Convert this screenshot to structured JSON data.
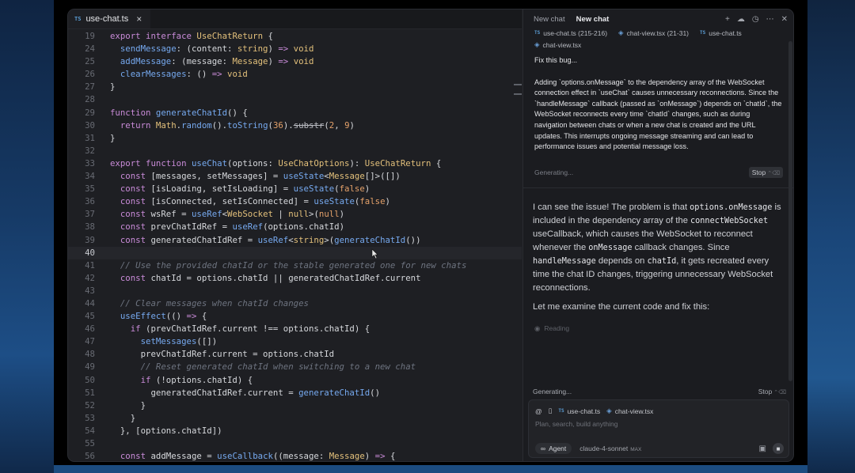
{
  "editor": {
    "tab": {
      "lang": "TS",
      "filename": "use-chat.ts",
      "close": "×"
    },
    "lines": [
      {
        "n": "19",
        "html": "<span class=\"kw\">export</span> <span class=\"kw\">interface</span> <span class=\"ty\">UseChatReturn</span> {"
      },
      {
        "n": "24",
        "html": "  <span class=\"fn\">sendMessage</span>: (content: <span class=\"ty\">string</span>) <span class=\"kw\">=&gt;</span> <span class=\"ty\">void</span>"
      },
      {
        "n": "25",
        "html": "  <span class=\"fn\">addMessage</span>: (message: <span class=\"ty\">Message</span>) <span class=\"kw\">=&gt;</span> <span class=\"ty\">void</span>"
      },
      {
        "n": "26",
        "html": "  <span class=\"fn\">clearMessages</span>: () <span class=\"kw\">=&gt;</span> <span class=\"ty\">void</span>"
      },
      {
        "n": "27",
        "html": "}"
      },
      {
        "n": "28",
        "html": ""
      },
      {
        "n": "29",
        "html": "<span class=\"kw\">function</span> <span class=\"fn\">generateChatId</span>() {"
      },
      {
        "n": "30",
        "html": "  <span class=\"kw\">return</span> <span class=\"ty\">Math</span>.<span class=\"fn\">random</span>().<span class=\"fn\">toString</span>(<span class=\"nm\">36</span>).<span class=\"strike\">substr</span>(<span class=\"nm\">2</span>, <span class=\"nm\">9</span>)"
      },
      {
        "n": "31",
        "html": "}"
      },
      {
        "n": "32",
        "html": ""
      },
      {
        "n": "33",
        "html": "<span class=\"kw\">export</span> <span class=\"kw\">function</span> <span class=\"fn\">useChat</span>(options: <span class=\"ty\">UseChatOptions</span>): <span class=\"ty\">UseChatReturn</span> {"
      },
      {
        "n": "34",
        "html": "  <span class=\"kw\">const</span> [messages, setMessages] = <span class=\"fn\">useState</span>&lt;<span class=\"ty\">Message</span>[]&gt;([])"
      },
      {
        "n": "35",
        "html": "  <span class=\"kw\">const</span> [isLoading, setIsLoading] = <span class=\"fn\">useState</span>(<span class=\"nm\">false</span>)"
      },
      {
        "n": "36",
        "html": "  <span class=\"kw\">const</span> [isConnected, setIsConnected] = <span class=\"fn\">useState</span>(<span class=\"nm\">false</span>)"
      },
      {
        "n": "37",
        "html": "  <span class=\"kw\">const</span> wsRef = <span class=\"fn\">useRef</span>&lt;<span class=\"ty\">WebSocket</span> | <span class=\"ty\">null</span>&gt;(<span class=\"nm\">null</span>)"
      },
      {
        "n": "38",
        "html": "  <span class=\"kw\">const</span> prevChatIdRef = <span class=\"fn\">useRef</span>(options.chatId)"
      },
      {
        "n": "39",
        "html": "  <span class=\"kw\">const</span> generatedChatIdRef = <span class=\"fn\">useRef</span>&lt;<span class=\"ty\">string</span>&gt;(<span class=\"fn\">generateChatId</span>())"
      },
      {
        "n": "40",
        "html": "",
        "active": true
      },
      {
        "n": "41",
        "html": "  <span class=\"cm\">// Use the provided chatId or the stable generated one for new chats</span>"
      },
      {
        "n": "42",
        "html": "  <span class=\"kw\">const</span> chatId = options.chatId || generatedChatIdRef.current"
      },
      {
        "n": "43",
        "html": ""
      },
      {
        "n": "44",
        "html": "  <span class=\"cm\">// Clear messages when chatId changes</span>"
      },
      {
        "n": "45",
        "html": "  <span class=\"fn\">useEffect</span>(() <span class=\"kw\">=&gt;</span> {"
      },
      {
        "n": "46",
        "html": "    <span class=\"kw\">if</span> (prevChatIdRef.current !== options.chatId) {"
      },
      {
        "n": "47",
        "html": "      <span class=\"fn\">setMessages</span>([])"
      },
      {
        "n": "48",
        "html": "      prevChatIdRef.current = options.chatId"
      },
      {
        "n": "49",
        "html": "      <span class=\"cm\">// Reset generated chatId when switching to a new chat</span>"
      },
      {
        "n": "50",
        "html": "      <span class=\"kw\">if</span> (!options.chatId) {"
      },
      {
        "n": "51",
        "html": "        generatedChatIdRef.current = <span class=\"fn\">generateChatId</span>()"
      },
      {
        "n": "52",
        "html": "      }"
      },
      {
        "n": "53",
        "html": "    }"
      },
      {
        "n": "54",
        "html": "  }, [options.chatId])"
      },
      {
        "n": "55",
        "html": ""
      },
      {
        "n": "56",
        "html": "  <span class=\"kw\">const</span> addMessage = <span class=\"fn\">useCallback</span>((message: <span class=\"ty\">Message</span>) <span class=\"kw\">=&gt;</span> {"
      }
    ]
  },
  "chat": {
    "tabs": [
      "New chat",
      "New chat"
    ],
    "icons": [
      "plus-icon",
      "cloud-icon",
      "history-icon",
      "more-icon",
      "close-icon"
    ],
    "context_chips": [
      {
        "badge": "TS",
        "label": "use-chat.ts (215-216)"
      },
      {
        "badge": "◈",
        "label": "chat-view.tsx (21-31)"
      },
      {
        "badge": "TS",
        "label": "use-chat.ts"
      },
      {
        "badge": "◈",
        "label": "chat-view.tsx"
      }
    ],
    "user_message": {
      "line1": "Fix this bug...",
      "body": "Adding `options.onMessage` to the dependency array of the WebSocket connection effect in `useChat` causes unnecessary reconnections. Since the `handleMessage` callback (passed as `onMessage`) depends on `chatId`, the WebSocket reconnects every time `chatId` changes, such as during navigation between chats or when a new chat is created and the URL updates. This interrupts ongoing message streaming and can lead to performance issues and potential message loss."
    },
    "generating_top": "Generating...",
    "stop_label": "Stop",
    "stop_keys": "⌃⌫",
    "ai_message": {
      "p1_a": "I can see the issue! The problem is that ",
      "p1_code1": "options.onMessage",
      "p1_b": " is included in the dependency array of the ",
      "p1_code2": "connectWebSocket",
      "p1_c": " useCallback, which causes the WebSocket to reconnect whenever the ",
      "p1_code3": "onMessage",
      "p1_d": " callback changes. Since ",
      "p1_code4": "handleMessage",
      "p1_e": " depends on ",
      "p1_code5": "chatId",
      "p1_f": ", it gets recreated every time the chat ID changes, triggering unnecessary WebSocket reconnections.",
      "p2": "Let me examine the current code and fix this:"
    },
    "reading": "Reading",
    "generating_bottom": "Generating...",
    "composer": {
      "at": "@",
      "files": [
        {
          "badge": "TS",
          "label": "use-chat.ts"
        },
        {
          "badge": "◈",
          "label": "chat-view.tsx"
        }
      ],
      "placeholder": "Plan, search, build anything",
      "agent": "Agent",
      "model": "claude-4-sonnet",
      "model_badge": "MAX"
    }
  }
}
